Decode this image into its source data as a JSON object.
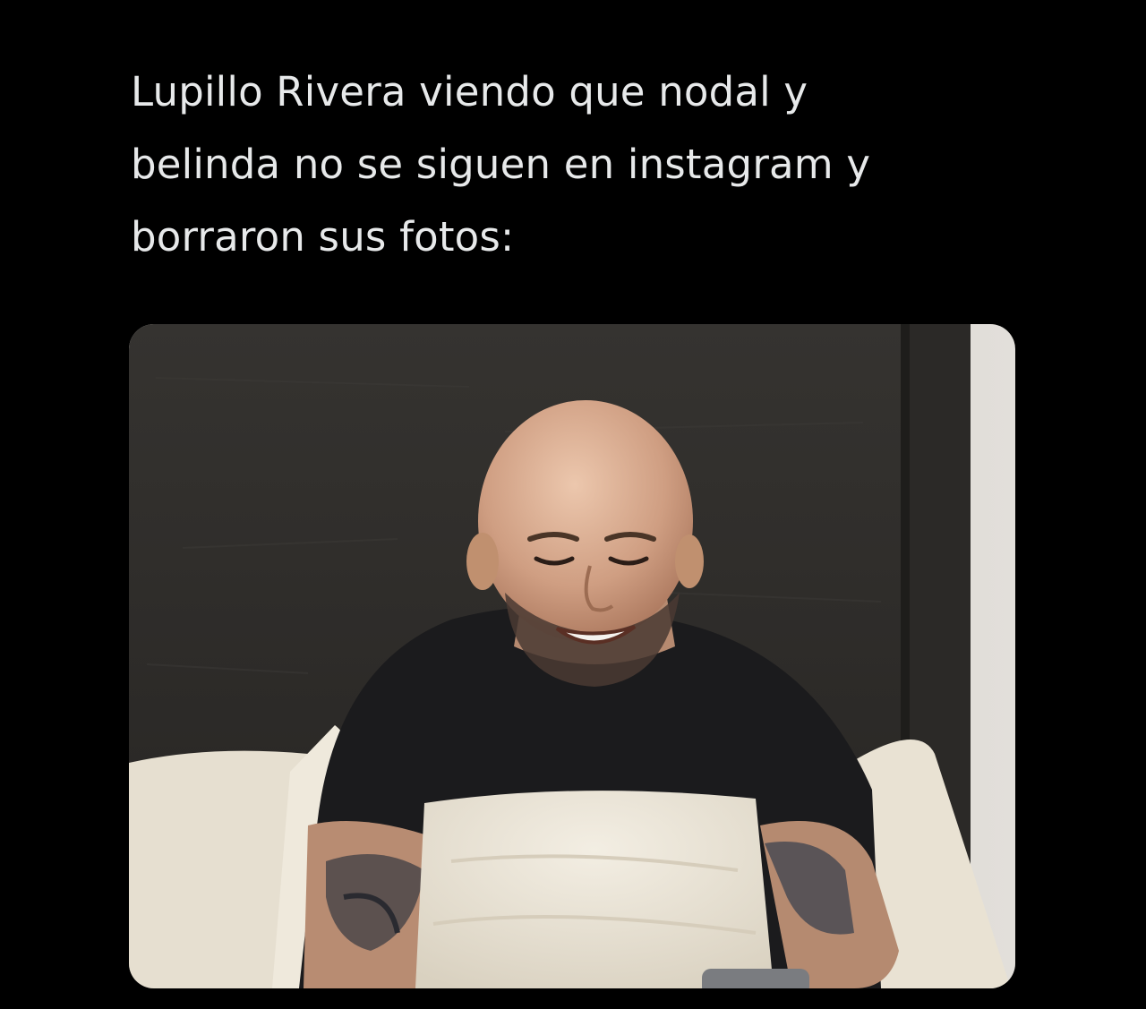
{
  "tweet": {
    "text_lines": [
      "Lupillo Rivera viendo que nodal y",
      "belinda no se siguen en instagram y",
      "borraron sus fotos:"
    ]
  },
  "media": {
    "kind": "photo",
    "subject": "bald smiling man in black t-shirt sitting in bed under white sheets"
  },
  "colors": {
    "background": "#000000",
    "text": "#e7e9ea",
    "headboard": "#2e2c2a",
    "sheets": "#ece6d8",
    "shirt": "#1a1a1c",
    "skin": "#c79a80"
  }
}
